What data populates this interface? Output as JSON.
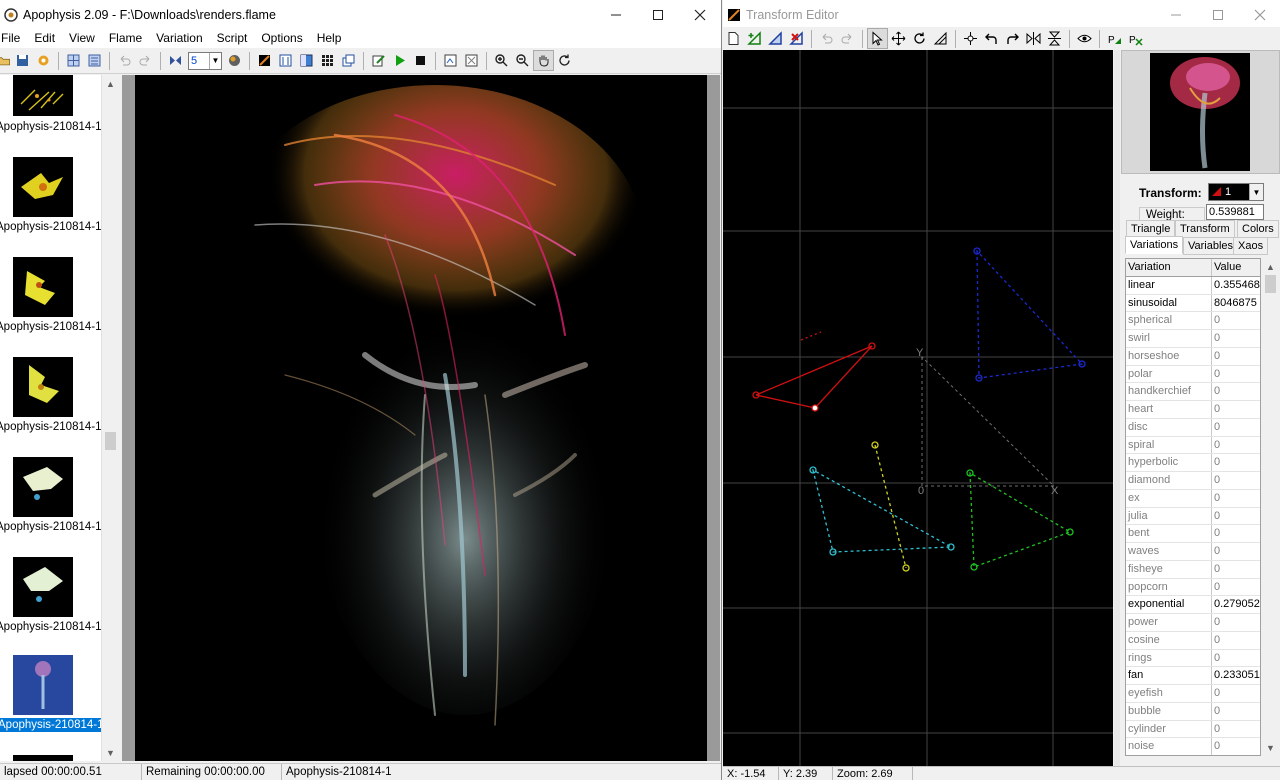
{
  "main_window": {
    "title": "Apophysis 2.09 - F:\\Downloads\\renders.flame",
    "menu": [
      "File",
      "Edit",
      "View",
      "Flame",
      "Variation",
      "Script",
      "Options",
      "Help"
    ],
    "toolbar_combo_value": "5",
    "thumbnails": [
      {
        "label": "Apophysis-210814-1",
        "color": "#d6c21a"
      },
      {
        "label": "Apophysis-210814-1",
        "color": "#e0d020"
      },
      {
        "label": "Apophysis-210814-1",
        "color": "#e8e030"
      },
      {
        "label": "Apophysis-210814-1",
        "color": "#e0e040"
      },
      {
        "label": "Apophysis-210814-1",
        "color": "#e8f0d0"
      },
      {
        "label": "Apophysis-210814-1",
        "color": "#e4f0d4"
      },
      {
        "label": "Apophysis-210814-1",
        "color": "#4060b0"
      }
    ],
    "selected_thumbnail": 6,
    "status": {
      "elapsed": "lapsed 00:00:00.51",
      "remaining": "Remaining 00:00:00.00",
      "name": "Apophysis-210814-1"
    }
  },
  "transform_editor": {
    "title": "Transform Editor",
    "transform_label": "Transform:",
    "transform_value": "1",
    "weight_label": "Weight:",
    "weight_value": "0.539881",
    "tabs_row1": [
      "Triangle",
      "Transform",
      "Colors"
    ],
    "tabs_row2": [
      "Variations",
      "Variables",
      "Xaos"
    ],
    "active_tab": "Variations",
    "grid_headers": [
      "Variation",
      "Value"
    ],
    "variations": [
      {
        "name": "linear",
        "value": "0.355468",
        "active": true
      },
      {
        "name": "sinusoidal",
        "value": "8046875",
        "active": true
      },
      {
        "name": "spherical",
        "value": "0",
        "active": false
      },
      {
        "name": "swirl",
        "value": "0",
        "active": false
      },
      {
        "name": "horseshoe",
        "value": "0",
        "active": false
      },
      {
        "name": "polar",
        "value": "0",
        "active": false
      },
      {
        "name": "handkerchief",
        "value": "0",
        "active": false
      },
      {
        "name": "heart",
        "value": "0",
        "active": false
      },
      {
        "name": "disc",
        "value": "0",
        "active": false
      },
      {
        "name": "spiral",
        "value": "0",
        "active": false
      },
      {
        "name": "hyperbolic",
        "value": "0",
        "active": false
      },
      {
        "name": "diamond",
        "value": "0",
        "active": false
      },
      {
        "name": "ex",
        "value": "0",
        "active": false
      },
      {
        "name": "julia",
        "value": "0",
        "active": false
      },
      {
        "name": "bent",
        "value": "0",
        "active": false
      },
      {
        "name": "waves",
        "value": "0",
        "active": false
      },
      {
        "name": "fisheye",
        "value": "0",
        "active": false
      },
      {
        "name": "popcorn",
        "value": "0",
        "active": false
      },
      {
        "name": "exponential",
        "value": "0.279052",
        "active": true
      },
      {
        "name": "power",
        "value": "0",
        "active": false
      },
      {
        "name": "cosine",
        "value": "0",
        "active": false
      },
      {
        "name": "rings",
        "value": "0",
        "active": false
      },
      {
        "name": "fan",
        "value": "0.233051",
        "active": true
      },
      {
        "name": "eyefish",
        "value": "0",
        "active": false
      },
      {
        "name": "bubble",
        "value": "0",
        "active": false
      },
      {
        "name": "cylinder",
        "value": "0",
        "active": false
      },
      {
        "name": "noise",
        "value": "0",
        "active": false
      }
    ],
    "canvas_labels": {
      "y_axis": "Y",
      "origin": "0",
      "x_axis": "X"
    },
    "triangle_colors": [
      "#d01010",
      "#1a2ad0",
      "#30c0d0",
      "#d0d020",
      "#20c020"
    ],
    "status": {
      "x": "X: -1.54",
      "y": "Y: 2.39",
      "zoom": "Zoom: 2.69"
    }
  }
}
